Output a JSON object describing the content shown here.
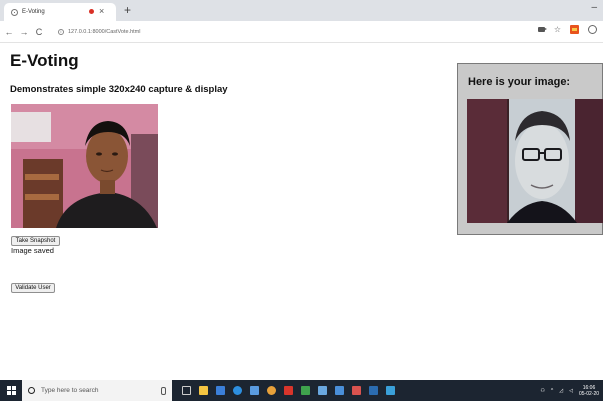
{
  "browser": {
    "tab_title": "E-Voting",
    "tab_close": "×",
    "new_tab": "+",
    "minimize": "–",
    "url": "127.0.0.1:8000/CastVote.html"
  },
  "page": {
    "title": "E-Voting",
    "subtitle": "Demonstrates simple 320x240 capture & display",
    "snapshot_button": "Take Snapshot",
    "status": "Image saved",
    "validate_button": "Validate User",
    "result_heading": "Here is your image:"
  },
  "taskbar": {
    "search_placeholder": "Type here to search",
    "time": "16:06",
    "date": "05-02-20"
  },
  "colors": {
    "taskbar_bg": "#1c2531",
    "panel_bg": "#c9c9c9",
    "recording_dot": "#d93025"
  },
  "icons": [
    "globe-icon",
    "recording-dot-icon",
    "close-icon",
    "plus-icon",
    "back-icon",
    "forward-icon",
    "reload-icon",
    "info-icon",
    "camera-icon",
    "star-icon",
    "extension-icon",
    "profile-icon",
    "windows-start-icon",
    "search-icon",
    "microphone-icon"
  ]
}
